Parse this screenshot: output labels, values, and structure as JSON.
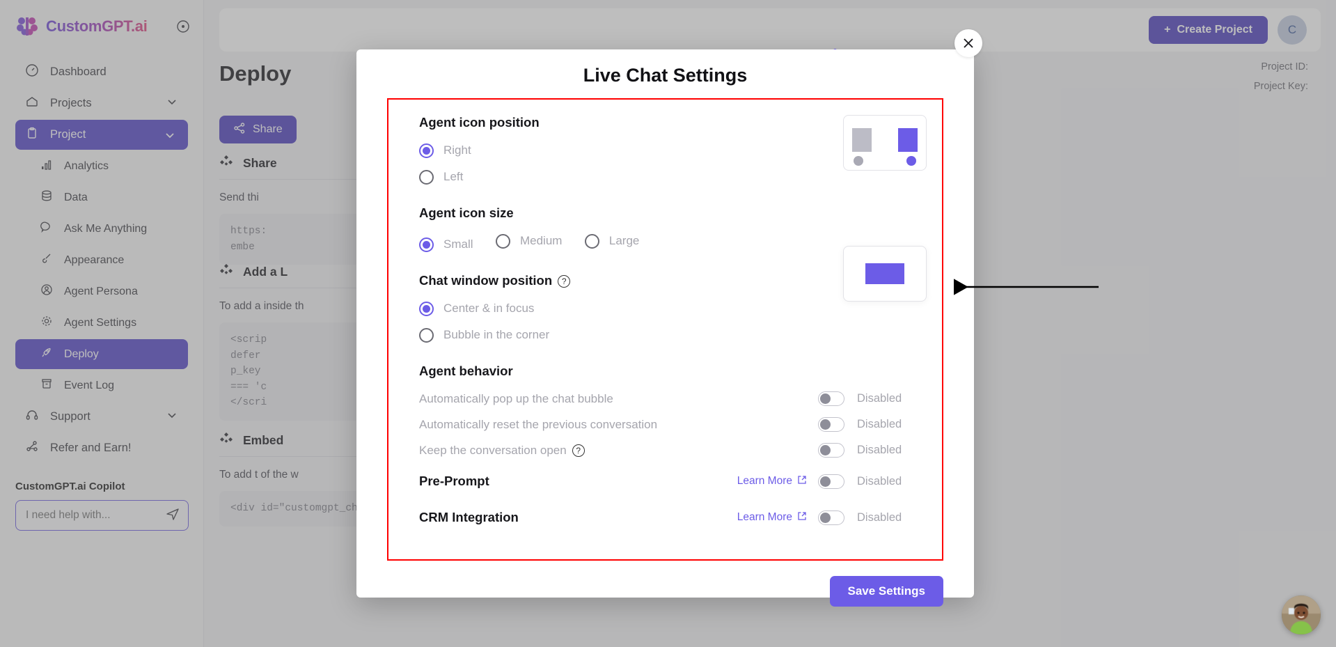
{
  "brand": {
    "name": "CustomGPT.ai",
    "logo_icon": "brain-logo-icon",
    "toggle_icon": "collapse-sidebar-icon"
  },
  "sidebar": {
    "items": [
      {
        "label": "Dashboard",
        "icon": "speedometer-icon",
        "level": "top",
        "active": false,
        "chevron": false
      },
      {
        "label": "Projects",
        "icon": "home-icon",
        "level": "top",
        "active": false,
        "chevron": true
      },
      {
        "label": "Project",
        "icon": "clipboard-icon",
        "level": "top",
        "active": true,
        "chevron": true
      },
      {
        "label": "Analytics",
        "icon": "bar-chart-icon",
        "level": "sub",
        "active": false,
        "chevron": false
      },
      {
        "label": "Data",
        "icon": "database-icon",
        "level": "sub",
        "active": false,
        "chevron": false
      },
      {
        "label": "Ask Me Anything",
        "icon": "chat-bubble-icon",
        "level": "sub",
        "active": false,
        "chevron": false
      },
      {
        "label": "Appearance",
        "icon": "paintbrush-icon",
        "level": "sub",
        "active": false,
        "chevron": false
      },
      {
        "label": "Agent Persona",
        "icon": "user-circle-icon",
        "level": "sub",
        "active": false,
        "chevron": false
      },
      {
        "label": "Agent Settings",
        "icon": "gear-icon",
        "level": "sub",
        "active": false,
        "chevron": false
      },
      {
        "label": "Deploy",
        "icon": "rocket-icon",
        "level": "sub",
        "active": true,
        "chevron": false
      },
      {
        "label": "Event Log",
        "icon": "archive-icon",
        "level": "sub",
        "active": false,
        "chevron": false
      },
      {
        "label": "Support",
        "icon": "headset-icon",
        "level": "top",
        "active": false,
        "chevron": true
      },
      {
        "label": "Refer and Earn!",
        "icon": "share-nodes-icon",
        "level": "top",
        "active": false,
        "chevron": false
      }
    ],
    "copilot": {
      "title": "CustomGPT.ai Copilot",
      "placeholder": "I need help with...",
      "send_icon": "send-icon"
    }
  },
  "topbar": {
    "create_project_label": "Create Project",
    "plus_icon": "plus-icon",
    "avatar_initial": "C"
  },
  "page": {
    "title": "Deploy",
    "project_id_label": "Project ID:",
    "project_key_label": "Project Key:",
    "share_button": "Share",
    "share_icon": "share-icon",
    "sections": [
      {
        "heading": "Share",
        "body": "Send thi",
        "code": "https:\nembe"
      },
      {
        "heading": "Add a L",
        "body": "To add a\ninside th",
        "code": "<scrip\ndefer\np_key\n=== 'c\n</scri"
      },
      {
        "heading": "Embed",
        "body": "To add t\nof the w",
        "code": "<div id=\"customgpt_chat\"></div> <script"
      }
    ]
  },
  "modal": {
    "title": "Live Chat Settings",
    "close_icon": "close-icon",
    "agent_icon_position": {
      "title": "Agent icon position",
      "options": [
        {
          "label": "Right",
          "selected": true
        },
        {
          "label": "Left",
          "selected": false
        }
      ]
    },
    "agent_icon_size": {
      "title": "Agent icon size",
      "options": [
        {
          "label": "Small",
          "selected": true
        },
        {
          "label": "Medium",
          "selected": false
        },
        {
          "label": "Large",
          "selected": false
        }
      ]
    },
    "chat_window_position": {
      "title": "Chat window position",
      "help_icon": "question-mark-icon",
      "options": [
        {
          "label": "Center & in focus",
          "selected": true
        },
        {
          "label": "Bubble in the corner",
          "selected": false
        }
      ]
    },
    "agent_behavior": {
      "title": "Agent behavior",
      "rows": [
        {
          "label": "Automatically pop up the chat bubble",
          "state": "Disabled",
          "enabled": false,
          "bold": false,
          "help": false,
          "learn_more": null
        },
        {
          "label": "Automatically reset the previous conversation",
          "state": "Disabled",
          "enabled": false,
          "bold": false,
          "help": false,
          "learn_more": null
        },
        {
          "label": "Keep the conversation open",
          "state": "Disabled",
          "enabled": false,
          "bold": false,
          "help": true,
          "learn_more": null
        },
        {
          "label": "Pre-Prompt",
          "state": "Disabled",
          "enabled": false,
          "bold": true,
          "help": false,
          "learn_more": "Learn More"
        },
        {
          "label": "CRM Integration",
          "state": "Disabled",
          "enabled": false,
          "bold": true,
          "help": false,
          "learn_more": "Learn More"
        }
      ]
    },
    "save_label": "Save Settings",
    "external_link_icon": "external-link-icon"
  },
  "colors": {
    "accent": "#6c5ce7",
    "sidebar_active": "#5546c8",
    "create_button": "#4e3fbd",
    "annotation": "#ff0000",
    "disabled_text": "#a5a5ad"
  },
  "annotation": {
    "arrow_icon": "left-arrow-annotation",
    "highlight_icon": "red-rectangle-highlight"
  },
  "chat_widget": {
    "icon": "support-agent-avatar"
  }
}
